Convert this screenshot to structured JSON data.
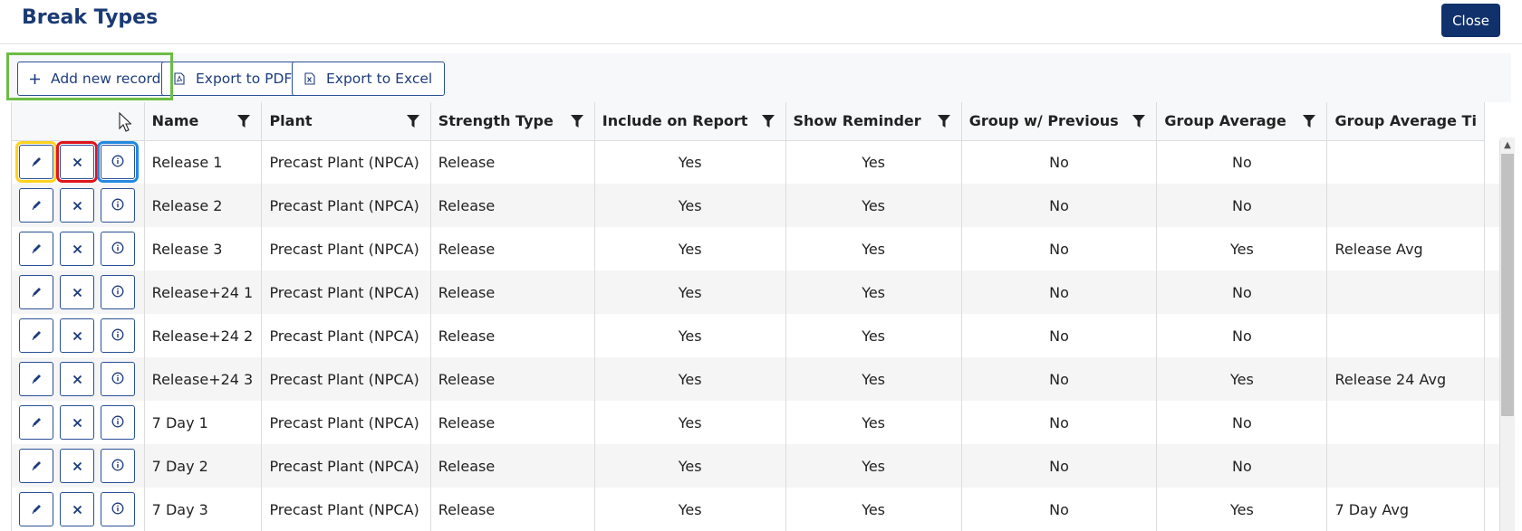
{
  "header": {
    "title": "Break Types",
    "close_label": "Close"
  },
  "toolbar": {
    "add_label": "Add new record",
    "pdf_label": "Export to PDF",
    "excel_label": "Export to Excel"
  },
  "columns": [
    "Name",
    "Plant",
    "Strength Type",
    "Include on Report",
    "Show Reminder",
    "Group w/ Previous",
    "Group Average",
    "Group Average Ti"
  ],
  "rows": [
    {
      "name": "Release 1",
      "plant": "Precast Plant (NPCA)",
      "strength": "Release",
      "include": "Yes",
      "reminder": "Yes",
      "group_prev": "No",
      "group_avg": "No",
      "group_avg_title": ""
    },
    {
      "name": "Release 2",
      "plant": "Precast Plant (NPCA)",
      "strength": "Release",
      "include": "Yes",
      "reminder": "Yes",
      "group_prev": "No",
      "group_avg": "No",
      "group_avg_title": ""
    },
    {
      "name": "Release 3",
      "plant": "Precast Plant (NPCA)",
      "strength": "Release",
      "include": "Yes",
      "reminder": "Yes",
      "group_prev": "No",
      "group_avg": "Yes",
      "group_avg_title": "Release Avg"
    },
    {
      "name": "Release+24 1",
      "plant": "Precast Plant (NPCA)",
      "strength": "Release",
      "include": "Yes",
      "reminder": "Yes",
      "group_prev": "No",
      "group_avg": "No",
      "group_avg_title": ""
    },
    {
      "name": "Release+24 2",
      "plant": "Precast Plant (NPCA)",
      "strength": "Release",
      "include": "Yes",
      "reminder": "Yes",
      "group_prev": "No",
      "group_avg": "No",
      "group_avg_title": ""
    },
    {
      "name": "Release+24 3",
      "plant": "Precast Plant (NPCA)",
      "strength": "Release",
      "include": "Yes",
      "reminder": "Yes",
      "group_prev": "No",
      "group_avg": "Yes",
      "group_avg_title": "Release 24 Avg"
    },
    {
      "name": "7 Day 1",
      "plant": "Precast Plant (NPCA)",
      "strength": "Release",
      "include": "Yes",
      "reminder": "Yes",
      "group_prev": "No",
      "group_avg": "No",
      "group_avg_title": ""
    },
    {
      "name": "7 Day 2",
      "plant": "Precast Plant (NPCA)",
      "strength": "Release",
      "include": "Yes",
      "reminder": "Yes",
      "group_prev": "No",
      "group_avg": "No",
      "group_avg_title": ""
    },
    {
      "name": "7 Day 3",
      "plant": "Precast Plant (NPCA)",
      "strength": "Release",
      "include": "Yes",
      "reminder": "Yes",
      "group_prev": "No",
      "group_avg": "Yes",
      "group_avg_title": "7 Day Avg"
    }
  ],
  "icons": {
    "add": "plus-icon",
    "pdf": "pdf-file-icon",
    "excel": "excel-file-icon",
    "filter": "filter-icon",
    "edit": "pencil-icon",
    "delete": "close-icon",
    "info": "info-icon"
  },
  "colors": {
    "title": "#1b3a75",
    "close_bg": "#10316b",
    "button_border": "#2a5096",
    "highlight_green": "#6cbd45",
    "highlight_yellow": "#ffd21f",
    "highlight_red": "#e0141e",
    "highlight_blue": "#2289e0"
  }
}
